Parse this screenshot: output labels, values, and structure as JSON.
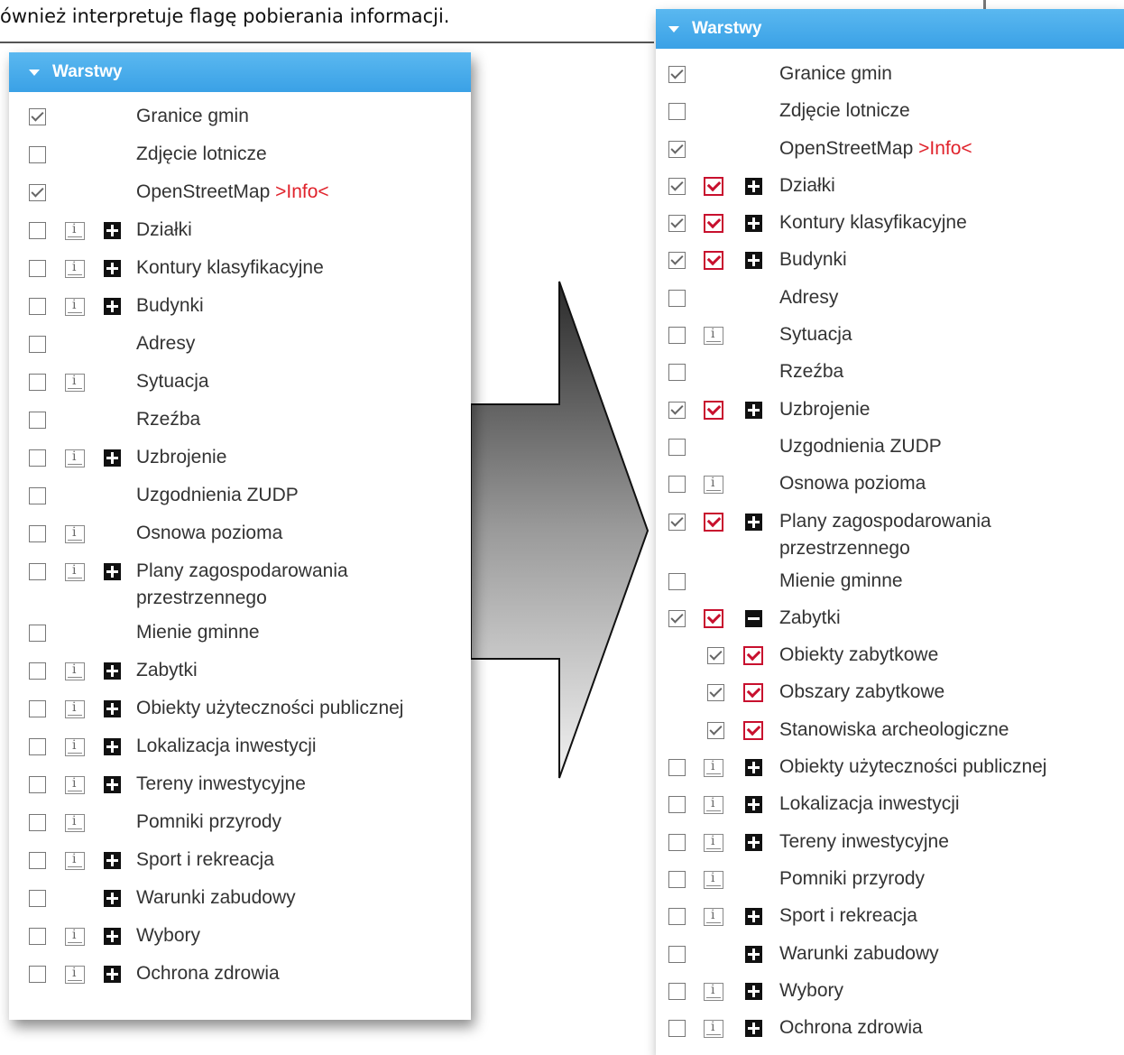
{
  "doc_text": "ównież interpretuje flagę pobierania informacji.",
  "left_panel": {
    "title": "Warstwy",
    "items": [
      {
        "label": "Granice gmin",
        "checked": true,
        "info": false,
        "expand": "none"
      },
      {
        "label": "Zdjęcie lotnicze",
        "checked": false,
        "info": false,
        "expand": "none"
      },
      {
        "label": "OpenStreetMap ",
        "suffix": ">Info<",
        "checked": true,
        "info": false,
        "expand": "none"
      },
      {
        "label": "Działki",
        "checked": false,
        "info": true,
        "expand": "plus"
      },
      {
        "label": "Kontury klasyfikacyjne",
        "checked": false,
        "info": true,
        "expand": "plus"
      },
      {
        "label": "Budynki",
        "checked": false,
        "info": true,
        "expand": "plus"
      },
      {
        "label": "Adresy",
        "checked": false,
        "info": false,
        "expand": "none"
      },
      {
        "label": "Sytuacja",
        "checked": false,
        "info": true,
        "expand": "none"
      },
      {
        "label": "Rzeźba",
        "checked": false,
        "info": false,
        "expand": "none"
      },
      {
        "label": "Uzbrojenie",
        "checked": false,
        "info": true,
        "expand": "plus"
      },
      {
        "label": "Uzgodnienia ZUDP",
        "checked": false,
        "info": false,
        "expand": "none"
      },
      {
        "label": "Osnowa pozioma",
        "checked": false,
        "info": true,
        "expand": "none"
      },
      {
        "label": "Plany zagospodarowania",
        "label2": "przestrzennego",
        "checked": false,
        "info": true,
        "expand": "plus"
      },
      {
        "label": "Mienie gminne",
        "checked": false,
        "info": false,
        "expand": "none"
      },
      {
        "label": "Zabytki",
        "checked": false,
        "info": true,
        "expand": "plus"
      },
      {
        "label": "Obiekty użyteczności publicznej",
        "checked": false,
        "info": true,
        "expand": "plus"
      },
      {
        "label": "Lokalizacja inwestycji",
        "checked": false,
        "info": true,
        "expand": "plus"
      },
      {
        "label": "Tereny inwestycyjne",
        "checked": false,
        "info": true,
        "expand": "plus"
      },
      {
        "label": "Pomniki przyrody",
        "checked": false,
        "info": true,
        "expand": "none"
      },
      {
        "label": "Sport i rekreacja",
        "checked": false,
        "info": true,
        "expand": "plus"
      },
      {
        "label": "Warunki zabudowy",
        "checked": false,
        "info": false,
        "expand": "plus"
      },
      {
        "label": "Wybory",
        "checked": false,
        "info": true,
        "expand": "plus"
      },
      {
        "label": "Ochrona zdrowia",
        "checked": false,
        "info": true,
        "expand": "plus"
      }
    ]
  },
  "right_panel": {
    "title": "Warstwy",
    "items": [
      {
        "label": "Granice gmin",
        "checked": true,
        "icon": "none",
        "expand": "none"
      },
      {
        "label": "Zdjęcie lotnicze",
        "checked": false,
        "icon": "none",
        "expand": "none"
      },
      {
        "label": "OpenStreetMap ",
        "suffix": ">Info<",
        "checked": true,
        "icon": "none",
        "expand": "none"
      },
      {
        "label": "Działki",
        "checked": true,
        "icon": "download",
        "expand": "plus"
      },
      {
        "label": "Kontury klasyfikacyjne",
        "checked": true,
        "icon": "download",
        "expand": "plus"
      },
      {
        "label": "Budynki",
        "checked": true,
        "icon": "download",
        "expand": "plus"
      },
      {
        "label": "Adresy",
        "checked": false,
        "icon": "none",
        "expand": "none"
      },
      {
        "label": "Sytuacja",
        "checked": false,
        "icon": "info",
        "expand": "none"
      },
      {
        "label": "Rzeźba",
        "checked": false,
        "icon": "none",
        "expand": "none"
      },
      {
        "label": "Uzbrojenie",
        "checked": true,
        "icon": "download",
        "expand": "plus"
      },
      {
        "label": "Uzgodnienia ZUDP",
        "checked": false,
        "icon": "none",
        "expand": "none"
      },
      {
        "label": "Osnowa pozioma",
        "checked": false,
        "icon": "info",
        "expand": "none"
      },
      {
        "label": "Plany zagospodarowania",
        "label2": "przestrzennego",
        "checked": true,
        "icon": "download",
        "expand": "plus"
      },
      {
        "label": "Mienie gminne",
        "checked": false,
        "icon": "none",
        "expand": "none"
      },
      {
        "label": "Zabytki",
        "checked": true,
        "icon": "download",
        "expand": "minus"
      },
      {
        "label": "Obiekty zabytkowe",
        "checked": true,
        "icon": "download",
        "expand": "none",
        "child": true
      },
      {
        "label": "Obszary zabytkowe",
        "checked": true,
        "icon": "download",
        "expand": "none",
        "child": true
      },
      {
        "label": "Stanowiska archeologiczne",
        "checked": true,
        "icon": "download",
        "expand": "none",
        "child": true
      },
      {
        "label": "Obiekty użyteczności publicznej",
        "checked": false,
        "icon": "info",
        "expand": "plus"
      },
      {
        "label": "Lokalizacja inwestycji",
        "checked": false,
        "icon": "info",
        "expand": "plus"
      },
      {
        "label": "Tereny inwestycyjne",
        "checked": false,
        "icon": "info",
        "expand": "plus"
      },
      {
        "label": "Pomniki przyrody",
        "checked": false,
        "icon": "info",
        "expand": "none"
      },
      {
        "label": "Sport i rekreacja",
        "checked": false,
        "icon": "info",
        "expand": "plus"
      },
      {
        "label": "Warunki zabudowy",
        "checked": false,
        "icon": "none",
        "expand": "plus"
      },
      {
        "label": "Wybory",
        "checked": false,
        "icon": "info",
        "expand": "plus"
      },
      {
        "label": "Ochrona zdrowia",
        "checked": false,
        "icon": "info",
        "expand": "plus"
      }
    ]
  }
}
